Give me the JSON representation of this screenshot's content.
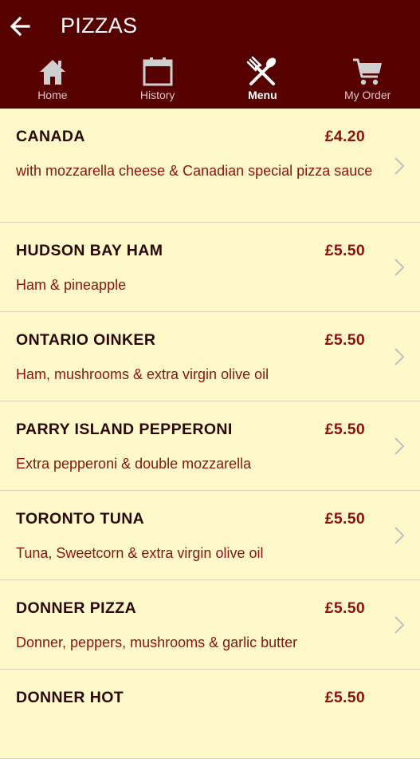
{
  "header": {
    "title": "PIZZAS",
    "back_icon": "arrow-left-icon"
  },
  "nav": {
    "items": [
      {
        "label": "Home",
        "icon": "home-icon",
        "active": false
      },
      {
        "label": "History",
        "icon": "calendar-icon",
        "active": false
      },
      {
        "label": "Menu",
        "icon": "fork-knife-icon",
        "active": true
      },
      {
        "label": "My Order",
        "icon": "cart-icon",
        "active": false
      }
    ]
  },
  "menu": {
    "items": [
      {
        "name": "CANADA",
        "price": "£4.20",
        "description": "with mozzarella cheese & Canadian special pizza sauce"
      },
      {
        "name": "HUDSON BAY HAM",
        "price": "£5.50",
        "description": "Ham & pineapple"
      },
      {
        "name": "ONTARIO OINKER",
        "price": "£5.50",
        "description": "Ham, mushrooms & extra virgin olive oil"
      },
      {
        "name": "PARRY ISLAND PEPPERONI",
        "price": "£5.50",
        "description": "Extra pepperoni & double mozzarella"
      },
      {
        "name": "TORONTO TUNA",
        "price": "£5.50",
        "description": "Tuna, Sweetcorn & extra virgin olive oil"
      },
      {
        "name": "DONNER PIZZA",
        "price": "£5.50",
        "description": "Donner, peppers, mushrooms & garlic butter"
      },
      {
        "name": "DONNER HOT",
        "price": "£5.50",
        "description": ""
      }
    ]
  },
  "colors": {
    "header_bg": "#560000",
    "list_bg": "#fff9c9",
    "price_text": "#8a1212",
    "name_text": "#2b0808"
  }
}
